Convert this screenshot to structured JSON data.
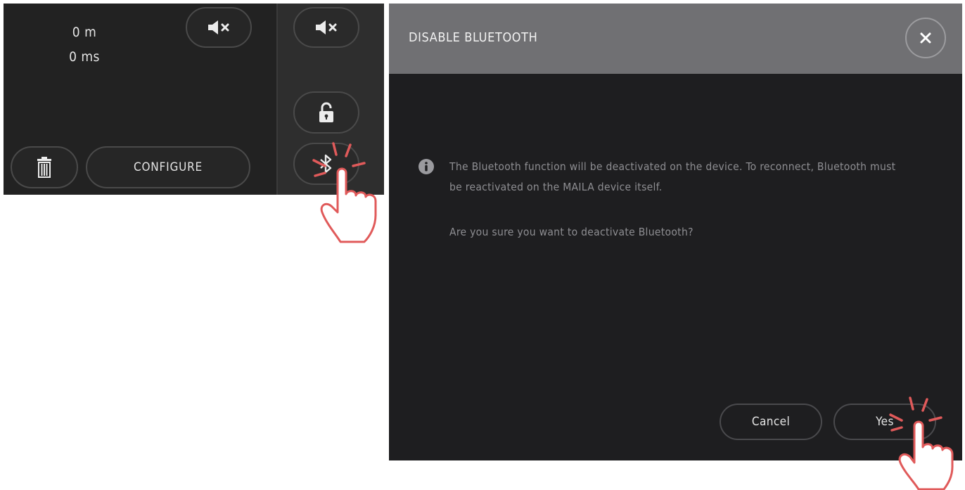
{
  "device": {
    "distance_value": "0 m",
    "delay_value": "0 ms",
    "configure_label": "CONFIGURE",
    "icons": {
      "mute_main": "speaker-muted-icon",
      "mute_sidebar": "speaker-muted-icon",
      "lock": "unlocked-padlock-icon",
      "bluetooth": "bluetooth-icon",
      "delete": "trash-icon"
    }
  },
  "dialog": {
    "title": "DISABLE BLUETOOTH",
    "message_line1": "The Bluetooth function will be deactivated on the device. To reconnect, Bluetooth must",
    "message_line2": "be reactivated on the MAILA device itself.",
    "question": "Are you sure you want to deactivate Bluetooth?",
    "cancel_label": "Cancel",
    "confirm_label": "Yes"
  },
  "colors": {
    "panel_bg": "#222222",
    "dialog_header": "#707073",
    "dialog_bg": "#1e1e20",
    "pointer_accent": "#e05a5a"
  }
}
